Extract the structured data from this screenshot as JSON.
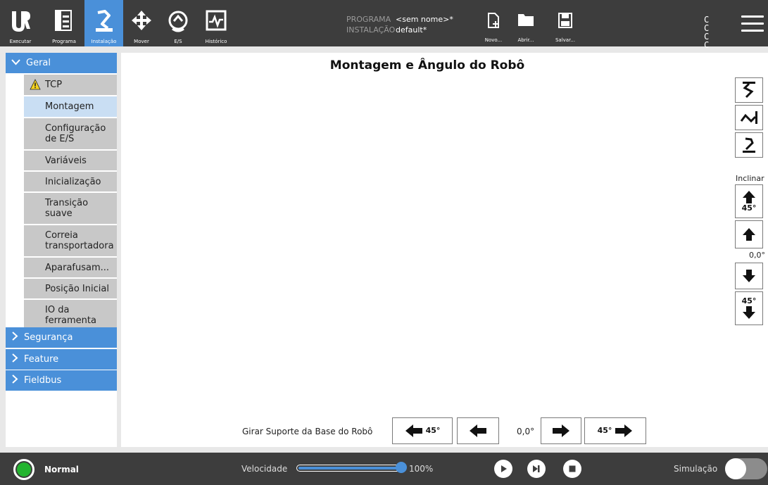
{
  "nav": {
    "run_label": "Executar",
    "program_label": "Programa",
    "installation_label": "Instalação",
    "move_label": "Mover",
    "io_label": "E/S",
    "log_label": "Histórico"
  },
  "program_info": {
    "program_key": "PROGRAMA",
    "program_value": "<sem nome>*",
    "installation_key": "INSTALAÇÃO",
    "installation_value": "default*"
  },
  "file_actions": {
    "new_label": "Novo...",
    "open_label": "Abrir...",
    "save_label": "Salvar..."
  },
  "cc_indicator": {
    "row1": "C C",
    "row2": "C C"
  },
  "sidebar": {
    "general": "Geral",
    "items": {
      "tcp": "TCP",
      "mounting": "Montagem",
      "io_setup": "Configuração de E/S",
      "variables": "Variáveis",
      "startup": "Inicialização",
      "smooth_transition": "Transição suave",
      "conveyor": "Correia transportadora",
      "screwdriving": "Aparafusam...",
      "home": "Posição Inicial",
      "tool_io": "IO da ferramenta"
    },
    "safety": "Segurança",
    "features": "Feature",
    "fieldbus": "Fieldbus"
  },
  "main": {
    "title": "Montagem e Ângulo do Robô",
    "tilt_label": "Inclinar",
    "tilt_up_45": "45°",
    "tilt_value": "0,0°",
    "tilt_down_45": "45°",
    "rotate_label": "Girar Suporte da Base do Robô",
    "rotate_left_45": "45°",
    "rotate_value": "0,0°",
    "rotate_right_45": "45°"
  },
  "footer": {
    "status": "Normal",
    "speed_label": "Velocidade",
    "speed_value": "100%",
    "speed_fraction": 1.0,
    "simulation_label": "Simulação"
  },
  "colors": {
    "accent": "#4a90d9",
    "header_bg": "#3d3d3d",
    "status_green": "#23b42f"
  }
}
